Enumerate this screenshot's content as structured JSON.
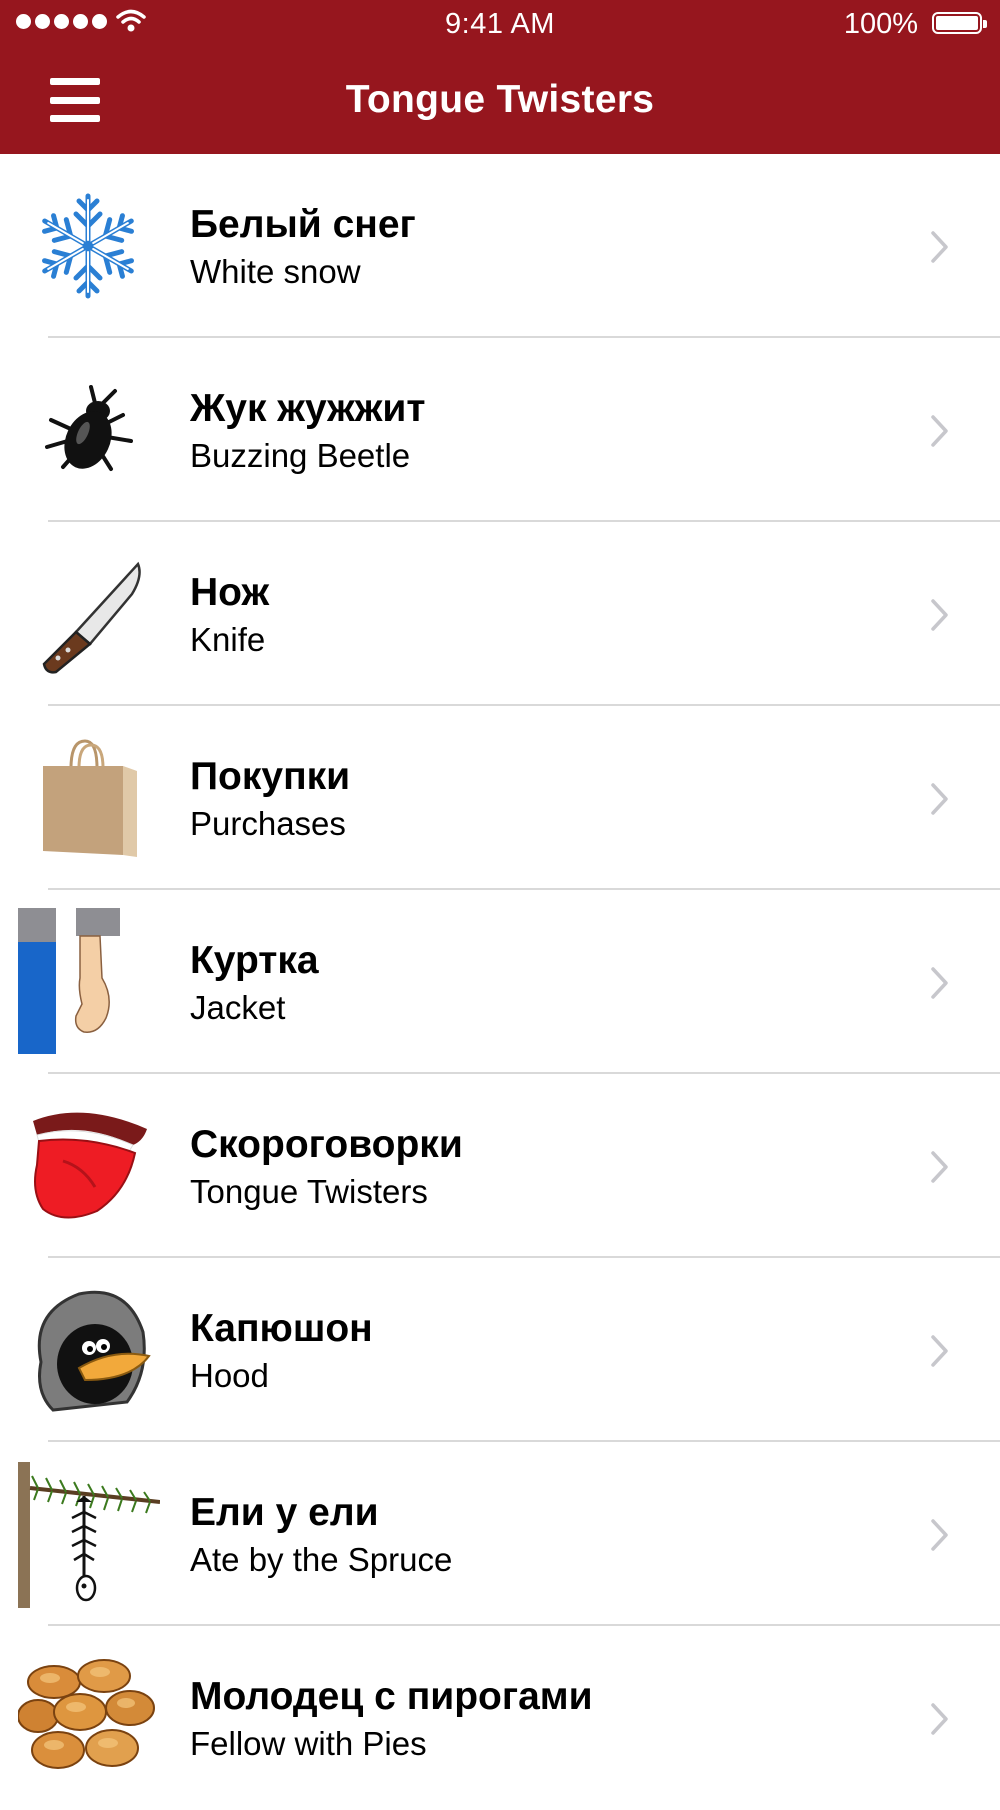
{
  "status_bar": {
    "time": "9:41 AM",
    "battery_percent": "100%",
    "battery_level": 1.0,
    "signal_bars": 5
  },
  "nav": {
    "title": "Tongue Twisters",
    "menu_icon": "hamburger-menu-icon"
  },
  "colors": {
    "bar": "#96161e",
    "separator": "#d9d9d9",
    "chevron": "#c7c7cc"
  },
  "items": [
    {
      "ru": "Белый снег",
      "en": "White snow",
      "icon": "snowflake-icon"
    },
    {
      "ru": "Жук жужжит",
      "en": "Buzzing Beetle",
      "icon": "beetle-icon"
    },
    {
      "ru": "Нож",
      "en": "Knife",
      "icon": "knife-icon"
    },
    {
      "ru": "Покупки",
      "en": "Purchases",
      "icon": "shopping-bag-icon"
    },
    {
      "ru": "Куртка",
      "en": "Jacket",
      "icon": "jacket-sleeve-icon"
    },
    {
      "ru": "Скороговорки",
      "en": "Tongue Twisters",
      "icon": "tongue-icon"
    },
    {
      "ru": "Капюшон",
      "en": "Hood",
      "icon": "hooded-bird-icon"
    },
    {
      "ru": "Ели у ели",
      "en": "Ate by the Spruce",
      "icon": "spruce-fishbone-icon"
    },
    {
      "ru": "Молодец с пирогами",
      "en": "Fellow with Pies",
      "icon": "pies-icon"
    }
  ]
}
